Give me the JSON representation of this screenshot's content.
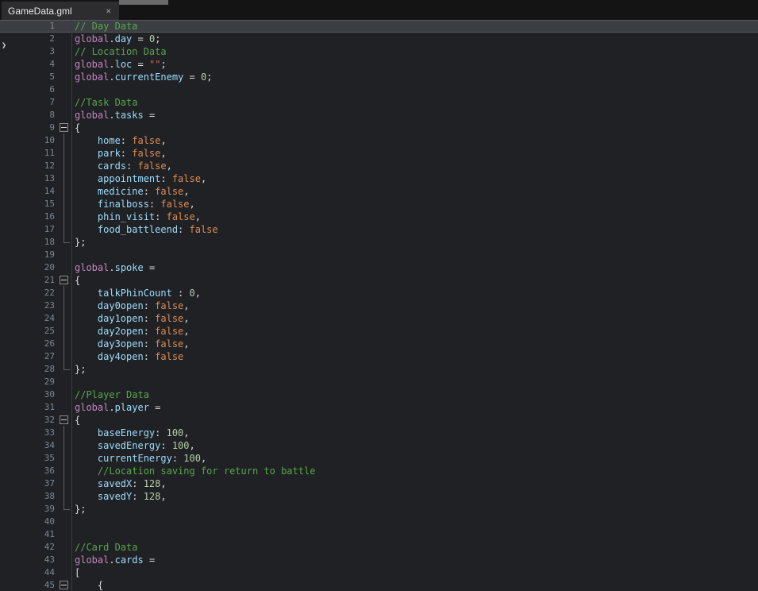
{
  "tab": {
    "title": "GameData.gml",
    "close_glyph": "✕"
  },
  "editor": {
    "arrow_glyph": "❯"
  },
  "colors": {
    "editor_bg": "#202124",
    "tabbar_bg": "#141414",
    "tab_bg": "#2D2D30",
    "line_highlight": "#3B3F43",
    "gutter_fg": "#7A8896",
    "tokens": {
      "comment": "#57A64A",
      "keyword": "#C586C0",
      "ident": "#9CDCFE",
      "number": "#B5CEA8",
      "string": "#D1694A",
      "bool": "#DD8D54",
      "punct": "#DCDCDC"
    }
  },
  "code": {
    "lines": [
      {
        "num": 1,
        "hl": true,
        "tokens": [
          {
            "t": "// Day Data",
            "c": "comment"
          }
        ]
      },
      {
        "num": 2,
        "tokens": [
          {
            "t": "global",
            "c": "keyword"
          },
          {
            "t": ".",
            "c": "punct"
          },
          {
            "t": "day",
            "c": "ident"
          },
          {
            "t": " = ",
            "c": "punct"
          },
          {
            "t": "0",
            "c": "number"
          },
          {
            "t": ";",
            "c": "punct"
          }
        ]
      },
      {
        "num": 3,
        "tokens": [
          {
            "t": "// Location Data",
            "c": "comment"
          }
        ]
      },
      {
        "num": 4,
        "tokens": [
          {
            "t": "global",
            "c": "keyword"
          },
          {
            "t": ".",
            "c": "punct"
          },
          {
            "t": "loc",
            "c": "ident"
          },
          {
            "t": " = ",
            "c": "punct"
          },
          {
            "t": "\"\"",
            "c": "string"
          },
          {
            "t": ";",
            "c": "punct"
          }
        ]
      },
      {
        "num": 5,
        "tokens": [
          {
            "t": "global",
            "c": "keyword"
          },
          {
            "t": ".",
            "c": "punct"
          },
          {
            "t": "currentEnemy",
            "c": "ident"
          },
          {
            "t": " = ",
            "c": "punct"
          },
          {
            "t": "0",
            "c": "number"
          },
          {
            "t": ";",
            "c": "punct"
          }
        ]
      },
      {
        "num": 6,
        "tokens": []
      },
      {
        "num": 7,
        "tokens": [
          {
            "t": "//Task Data",
            "c": "comment"
          }
        ]
      },
      {
        "num": 8,
        "tokens": [
          {
            "t": "global",
            "c": "keyword"
          },
          {
            "t": ".",
            "c": "punct"
          },
          {
            "t": "tasks",
            "c": "ident"
          },
          {
            "t": " =",
            "c": "punct"
          }
        ]
      },
      {
        "num": 9,
        "fold": "start",
        "tokens": [
          {
            "t": "{",
            "c": "punct"
          }
        ]
      },
      {
        "num": 10,
        "fold": "mid",
        "tokens": [
          {
            "t": "    home",
            "c": "ident"
          },
          {
            "t": ": ",
            "c": "punct"
          },
          {
            "t": "false",
            "c": "bool"
          },
          {
            "t": ",",
            "c": "punct"
          }
        ]
      },
      {
        "num": 11,
        "fold": "mid",
        "tokens": [
          {
            "t": "    park",
            "c": "ident"
          },
          {
            "t": ": ",
            "c": "punct"
          },
          {
            "t": "false",
            "c": "bool"
          },
          {
            "t": ",",
            "c": "punct"
          }
        ]
      },
      {
        "num": 12,
        "fold": "mid",
        "tokens": [
          {
            "t": "    cards",
            "c": "ident"
          },
          {
            "t": ": ",
            "c": "punct"
          },
          {
            "t": "false",
            "c": "bool"
          },
          {
            "t": ",",
            "c": "punct"
          }
        ]
      },
      {
        "num": 13,
        "fold": "mid",
        "tokens": [
          {
            "t": "    appointment",
            "c": "ident"
          },
          {
            "t": ": ",
            "c": "punct"
          },
          {
            "t": "false",
            "c": "bool"
          },
          {
            "t": ",",
            "c": "punct"
          }
        ]
      },
      {
        "num": 14,
        "fold": "mid",
        "tokens": [
          {
            "t": "    medicine",
            "c": "ident"
          },
          {
            "t": ": ",
            "c": "punct"
          },
          {
            "t": "false",
            "c": "bool"
          },
          {
            "t": ",",
            "c": "punct"
          }
        ]
      },
      {
        "num": 15,
        "fold": "mid",
        "tokens": [
          {
            "t": "    finalboss",
            "c": "ident"
          },
          {
            "t": ": ",
            "c": "punct"
          },
          {
            "t": "false",
            "c": "bool"
          },
          {
            "t": ",",
            "c": "punct"
          }
        ]
      },
      {
        "num": 16,
        "fold": "mid",
        "tokens": [
          {
            "t": "    phin_visit",
            "c": "ident"
          },
          {
            "t": ": ",
            "c": "punct"
          },
          {
            "t": "false",
            "c": "bool"
          },
          {
            "t": ",",
            "c": "punct"
          }
        ]
      },
      {
        "num": 17,
        "fold": "mid",
        "tokens": [
          {
            "t": "    food_battleend",
            "c": "ident"
          },
          {
            "t": ": ",
            "c": "punct"
          },
          {
            "t": "false",
            "c": "bool"
          }
        ]
      },
      {
        "num": 18,
        "fold": "end",
        "tokens": [
          {
            "t": "};",
            "c": "punct"
          }
        ]
      },
      {
        "num": 19,
        "tokens": []
      },
      {
        "num": 20,
        "tokens": [
          {
            "t": "global",
            "c": "keyword"
          },
          {
            "t": ".",
            "c": "punct"
          },
          {
            "t": "spoke",
            "c": "ident"
          },
          {
            "t": " =",
            "c": "punct"
          }
        ]
      },
      {
        "num": 21,
        "fold": "start",
        "tokens": [
          {
            "t": "{",
            "c": "punct"
          }
        ]
      },
      {
        "num": 22,
        "fold": "mid",
        "tokens": [
          {
            "t": "    talkPhinCount",
            "c": "ident"
          },
          {
            "t": " : ",
            "c": "punct"
          },
          {
            "t": "0",
            "c": "number"
          },
          {
            "t": ",",
            "c": "punct"
          }
        ]
      },
      {
        "num": 23,
        "fold": "mid",
        "tokens": [
          {
            "t": "    day0open",
            "c": "ident"
          },
          {
            "t": ": ",
            "c": "punct"
          },
          {
            "t": "false",
            "c": "bool"
          },
          {
            "t": ",",
            "c": "punct"
          }
        ]
      },
      {
        "num": 24,
        "fold": "mid",
        "tokens": [
          {
            "t": "    day1open",
            "c": "ident"
          },
          {
            "t": ": ",
            "c": "punct"
          },
          {
            "t": "false",
            "c": "bool"
          },
          {
            "t": ",",
            "c": "punct"
          }
        ]
      },
      {
        "num": 25,
        "fold": "mid",
        "tokens": [
          {
            "t": "    day2open",
            "c": "ident"
          },
          {
            "t": ": ",
            "c": "punct"
          },
          {
            "t": "false",
            "c": "bool"
          },
          {
            "t": ",",
            "c": "punct"
          }
        ]
      },
      {
        "num": 26,
        "fold": "mid",
        "tokens": [
          {
            "t": "    day3open",
            "c": "ident"
          },
          {
            "t": ": ",
            "c": "punct"
          },
          {
            "t": "false",
            "c": "bool"
          },
          {
            "t": ",",
            "c": "punct"
          }
        ]
      },
      {
        "num": 27,
        "fold": "mid",
        "tokens": [
          {
            "t": "    day4open",
            "c": "ident"
          },
          {
            "t": ": ",
            "c": "punct"
          },
          {
            "t": "false",
            "c": "bool"
          }
        ]
      },
      {
        "num": 28,
        "fold": "end",
        "tokens": [
          {
            "t": "};",
            "c": "punct"
          }
        ]
      },
      {
        "num": 29,
        "tokens": []
      },
      {
        "num": 30,
        "tokens": [
          {
            "t": "//Player Data",
            "c": "comment"
          }
        ]
      },
      {
        "num": 31,
        "tokens": [
          {
            "t": "global",
            "c": "keyword"
          },
          {
            "t": ".",
            "c": "punct"
          },
          {
            "t": "player",
            "c": "ident"
          },
          {
            "t": " =",
            "c": "punct"
          }
        ]
      },
      {
        "num": 32,
        "fold": "start",
        "tokens": [
          {
            "t": "{",
            "c": "punct"
          }
        ]
      },
      {
        "num": 33,
        "fold": "mid",
        "tokens": [
          {
            "t": "    baseEnergy",
            "c": "ident"
          },
          {
            "t": ": ",
            "c": "punct"
          },
          {
            "t": "100",
            "c": "number"
          },
          {
            "t": ",",
            "c": "punct"
          }
        ]
      },
      {
        "num": 34,
        "fold": "mid",
        "tokens": [
          {
            "t": "    savedEnergy",
            "c": "ident"
          },
          {
            "t": ": ",
            "c": "punct"
          },
          {
            "t": "100",
            "c": "number"
          },
          {
            "t": ",",
            "c": "punct"
          }
        ]
      },
      {
        "num": 35,
        "fold": "mid",
        "tokens": [
          {
            "t": "    currentEnergy",
            "c": "ident"
          },
          {
            "t": ": ",
            "c": "punct"
          },
          {
            "t": "100",
            "c": "number"
          },
          {
            "t": ",",
            "c": "punct"
          }
        ]
      },
      {
        "num": 36,
        "fold": "mid",
        "tokens": [
          {
            "t": "    //Location saving for return to battle",
            "c": "comment"
          }
        ]
      },
      {
        "num": 37,
        "fold": "mid",
        "tokens": [
          {
            "t": "    savedX",
            "c": "ident"
          },
          {
            "t": ": ",
            "c": "punct"
          },
          {
            "t": "128",
            "c": "number"
          },
          {
            "t": ",",
            "c": "punct"
          }
        ]
      },
      {
        "num": 38,
        "fold": "mid",
        "tokens": [
          {
            "t": "    savedY",
            "c": "ident"
          },
          {
            "t": ": ",
            "c": "punct"
          },
          {
            "t": "128",
            "c": "number"
          },
          {
            "t": ",",
            "c": "punct"
          }
        ]
      },
      {
        "num": 39,
        "fold": "end",
        "tokens": [
          {
            "t": "};",
            "c": "punct"
          }
        ]
      },
      {
        "num": 40,
        "tokens": []
      },
      {
        "num": 41,
        "tokens": []
      },
      {
        "num": 42,
        "tokens": [
          {
            "t": "//Card Data",
            "c": "comment"
          }
        ]
      },
      {
        "num": 43,
        "tokens": [
          {
            "t": "global",
            "c": "keyword"
          },
          {
            "t": ".",
            "c": "punct"
          },
          {
            "t": "cards",
            "c": "ident"
          },
          {
            "t": " =",
            "c": "punct"
          }
        ]
      },
      {
        "num": 44,
        "tokens": [
          {
            "t": "[",
            "c": "punct"
          }
        ]
      },
      {
        "num": 45,
        "fold": "start",
        "tokens": [
          {
            "t": "    {",
            "c": "punct"
          }
        ]
      }
    ]
  }
}
